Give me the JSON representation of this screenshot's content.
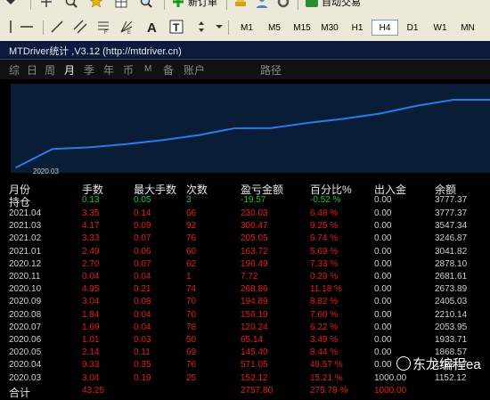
{
  "toolbar": {
    "new_order_label": "新订单",
    "autotrade_label": "自动交易",
    "timeframes": [
      "M1",
      "M5",
      "M15",
      "M30",
      "H1",
      "H4",
      "D1",
      "W1",
      "MN"
    ],
    "active_timeframe": "H4"
  },
  "window": {
    "title": "MTDriver统计 ,V3.12 (http://mtdriver.cn)"
  },
  "tabs": [
    {
      "label": "综",
      "active": false
    },
    {
      "label": "日",
      "active": false
    },
    {
      "label": "周",
      "active": false
    },
    {
      "label": "月",
      "active": true
    },
    {
      "label": "季",
      "active": false
    },
    {
      "label": "年",
      "active": false
    },
    {
      "label": "币",
      "active": false
    },
    {
      "label": "M",
      "active": false
    },
    {
      "label": "备",
      "active": false
    },
    {
      "label": "账户",
      "active": false
    },
    {
      "label": "路径",
      "active": false
    }
  ],
  "chart_data": {
    "type": "line",
    "x_label_shown": "2020.03",
    "x": [
      "2020.03",
      "2020.04",
      "2020.05",
      "2020.06",
      "2020.07",
      "2020.08",
      "2020.09",
      "2020.10",
      "2020.11",
      "2020.12",
      "2021.01",
      "2021.02",
      "2021.03",
      "2021.04"
    ],
    "values": [
      1152.12,
      1868.57,
      1933.71,
      2053.95,
      2210.14,
      2405.03,
      2673.89,
      2681.61,
      2878.1,
      3041.82,
      3246.87,
      3547.34,
      3777.37,
      3777.37
    ],
    "line_color": "#2c7be5"
  },
  "table": {
    "headers": [
      "月份",
      "手数",
      "最大手数",
      "次数",
      "盈亏金额",
      "百分比%",
      "出入金",
      "余额"
    ],
    "holding": {
      "month": "持仓",
      "lots": "0.13",
      "max_lots": "0.05",
      "count": "3",
      "pnl": "-19.57",
      "pct": "-0.52 %",
      "flow": "0.00",
      "balance": "3777.37"
    },
    "rows": [
      {
        "month": "2021.04",
        "lots": "3.35",
        "max_lots": "0.14",
        "count": "66",
        "pnl": "230.03",
        "pct": "6.48 %",
        "flow": "0.00",
        "balance": "3777.37"
      },
      {
        "month": "2021.03",
        "lots": "4.17",
        "max_lots": "0.09",
        "count": "92",
        "pnl": "300.47",
        "pct": "9.25 %",
        "flow": "0.00",
        "balance": "3547.34"
      },
      {
        "month": "2021.02",
        "lots": "3.33",
        "max_lots": "0.07",
        "count": "76",
        "pnl": "205.05",
        "pct": "6.74 %",
        "flow": "0.00",
        "balance": "3246.87"
      },
      {
        "month": "2021.01",
        "lots": "2.49",
        "max_lots": "0.06",
        "count": "60",
        "pnl": "163.72",
        "pct": "5.69 %",
        "flow": "0.00",
        "balance": "3041.82"
      },
      {
        "month": "2020.12",
        "lots": "2.70",
        "max_lots": "0.07",
        "count": "62",
        "pnl": "196.49",
        "pct": "7.33 %",
        "flow": "0.00",
        "balance": "2878.10"
      },
      {
        "month": "2020.11",
        "lots": "0.04",
        "max_lots": "0.04",
        "count": "1",
        "pnl": "7.72",
        "pct": "0.29 %",
        "flow": "0.00",
        "balance": "2681.61"
      },
      {
        "month": "2020.10",
        "lots": "4.95",
        "max_lots": "0.21",
        "count": "74",
        "pnl": "268.86",
        "pct": "11.18 %",
        "flow": "0.00",
        "balance": "2673.89"
      },
      {
        "month": "2020.09",
        "lots": "3.04",
        "max_lots": "0.08",
        "count": "70",
        "pnl": "194.89",
        "pct": "8.82 %",
        "flow": "0.00",
        "balance": "2405.03"
      },
      {
        "month": "2020.08",
        "lots": "1.84",
        "max_lots": "0.04",
        "count": "70",
        "pnl": "156.19",
        "pct": "7.60 %",
        "flow": "0.00",
        "balance": "2210.14"
      },
      {
        "month": "2020.07",
        "lots": "1.69",
        "max_lots": "0.04",
        "count": "78",
        "pnl": "120.24",
        "pct": "6.22 %",
        "flow": "0.00",
        "balance": "2053.95"
      },
      {
        "month": "2020.06",
        "lots": "1.01",
        "max_lots": "0.03",
        "count": "50",
        "pnl": "65.14",
        "pct": "3.49 %",
        "flow": "0.00",
        "balance": "1933.71"
      },
      {
        "month": "2020.05",
        "lots": "2.14",
        "max_lots": "0.11",
        "count": "69",
        "pnl": "145.40",
        "pct": "8.44 %",
        "flow": "0.00",
        "balance": "1868.57"
      },
      {
        "month": "2020.04",
        "lots": "9.33",
        "max_lots": "0.35",
        "count": "76",
        "pnl": "571.05",
        "pct": "49.57 %",
        "flow": "0.00",
        "balance": "1723.17"
      },
      {
        "month": "2020.03",
        "lots": "3.04",
        "max_lots": "0.19",
        "count": "25",
        "pnl": "152.12",
        "pct": "15.21 %",
        "flow": "1000.00",
        "balance": "1152.12"
      }
    ],
    "total": {
      "month": "合计",
      "lots": "43.25",
      "max_lots": "",
      "count": "",
      "pnl": "2757.80",
      "pct": "275.78 %",
      "flow": "1000.00",
      "balance": ""
    }
  },
  "watermark": "东龙编程ea"
}
